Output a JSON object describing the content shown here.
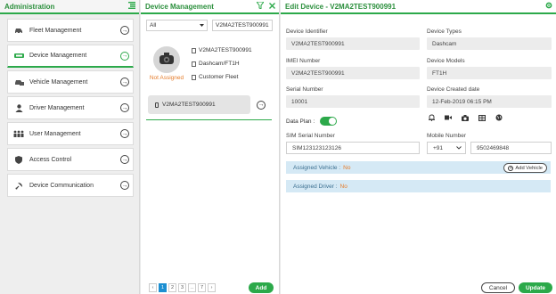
{
  "admin": {
    "title": "Administration",
    "menu": [
      {
        "label": "Fleet Management",
        "icon": "car-icon"
      },
      {
        "label": "Device Management",
        "icon": "device-icon"
      },
      {
        "label": "Vehicle Management",
        "icon": "vehicle-icon"
      },
      {
        "label": "Driver Management",
        "icon": "driver-icon"
      },
      {
        "label": "User Management",
        "icon": "users-icon"
      },
      {
        "label": "Access Control",
        "icon": "shield-icon"
      },
      {
        "label": "Device Communication",
        "icon": "satellite-icon"
      }
    ],
    "active_index": 1
  },
  "devices": {
    "title": "Device Management",
    "filter_value": "All",
    "search_value": "V2MA2TEST900991",
    "card": {
      "status": "Not Assigned",
      "identifier": "V2MA2TEST900991",
      "model": "Dashcam/FT1H",
      "fleet": "Customer Fleet",
      "pill": "V2MA2TEST900991"
    },
    "pager": [
      "‹",
      "1",
      "2",
      "3",
      "..",
      "7",
      "›"
    ],
    "current_page": "1",
    "add_label": "Add"
  },
  "edit": {
    "title": "Edit Device - V2MA2TEST900991",
    "fields": {
      "device_identifier": {
        "label": "Device Identifier",
        "value": "V2MA2TEST900991"
      },
      "device_types": {
        "label": "Device Types",
        "value": "Dashcam"
      },
      "imei": {
        "label": "IMEI Number",
        "value": "V2MA2TEST900991"
      },
      "device_models": {
        "label": "Device Models",
        "value": "FT1H"
      },
      "serial": {
        "label": "Serial Number",
        "value": "10001"
      },
      "created": {
        "label": "Device Created date",
        "value": "12-Feb-2019 06:15 PM"
      },
      "sim": {
        "label": "SIM Serial Number",
        "value": "SIM123123123126"
      },
      "mobile": {
        "label": "Mobile Number",
        "code": "+91",
        "value": "9502469848"
      }
    },
    "data_plan_label": "Data Plan :",
    "data_plan_on": true,
    "assigned_vehicle": {
      "label": "Assigned Vehicle :",
      "value": "No",
      "button": "Add Vehicle"
    },
    "assigned_driver": {
      "label": "Assigned Driver :",
      "value": "No"
    },
    "cancel_label": "Cancel",
    "update_label": "Update"
  },
  "colors": {
    "accent": "#2ca94a",
    "warning": "#e57c2b",
    "info_bar": "#d5e9f5",
    "page_current": "#1d8fd1"
  }
}
